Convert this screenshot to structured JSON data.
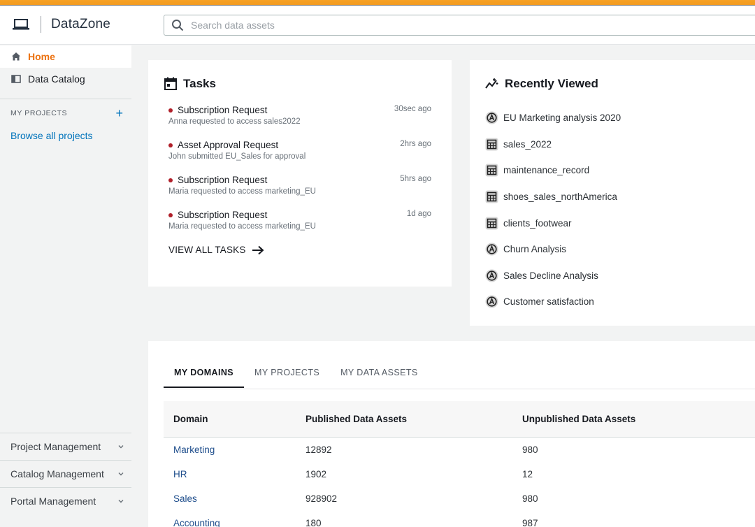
{
  "header": {
    "app_name": "DataZone",
    "search_placeholder": "Search data assets",
    "accent_color": "#f29a1f"
  },
  "sidebar": {
    "items": [
      {
        "label": "Home",
        "icon": "home-icon",
        "active": true
      },
      {
        "label": "Data Catalog",
        "icon": "catalog-icon",
        "active": false
      }
    ],
    "my_projects_label": "MY PROJECTS",
    "browse_label": "Browse all projects",
    "bottom_items": [
      {
        "label": "Project Management"
      },
      {
        "label": "Catalog Management"
      },
      {
        "label": "Portal Management"
      }
    ]
  },
  "tasks": {
    "title": "Tasks",
    "items": [
      {
        "title": "Subscription Request",
        "desc": "Anna requested to access sales2022",
        "time": "30sec ago"
      },
      {
        "title": "Asset Approval Request",
        "desc": "John submitted EU_Sales for approval",
        "time": "2hrs ago"
      },
      {
        "title": "Subscription Request",
        "desc": "Maria requested to access marketing_EU",
        "time": "5hrs ago"
      },
      {
        "title": "Subscription Request",
        "desc": "Maria requested to access marketing_EU",
        "time": "1d ago"
      }
    ],
    "view_all_label": "VIEW ALL TASKS"
  },
  "recent": {
    "title": "Recently Viewed",
    "items": [
      {
        "label": "EU Marketing analysis 2020",
        "icon": "analysis-icon"
      },
      {
        "label": "sales_2022",
        "icon": "table-icon"
      },
      {
        "label": "maintenance_record",
        "icon": "table-icon"
      },
      {
        "label": "shoes_sales_northAmerica",
        "icon": "table-icon"
      },
      {
        "label": "clients_footwear",
        "icon": "table-icon"
      },
      {
        "label": "Churn Analysis",
        "icon": "analysis-icon"
      },
      {
        "label": "Sales Decline Analysis",
        "icon": "analysis-icon"
      },
      {
        "label": "Customer satisfaction",
        "icon": "analysis-icon"
      }
    ]
  },
  "domains": {
    "tabs": [
      "MY DOMAINS",
      "MY PROJECTS",
      "MY DATA ASSETS"
    ],
    "columns": [
      "Domain",
      "Published Data Assets",
      "Unpublished Data Assets"
    ],
    "rows": [
      {
        "domain": "Marketing",
        "published": "12892",
        "unpublished": "980"
      },
      {
        "domain": "HR",
        "published": "1902",
        "unpublished": "12"
      },
      {
        "domain": "Sales",
        "published": "928902",
        "unpublished": "980"
      },
      {
        "domain": "Accounting",
        "published": "180",
        "unpublished": "987"
      }
    ]
  }
}
